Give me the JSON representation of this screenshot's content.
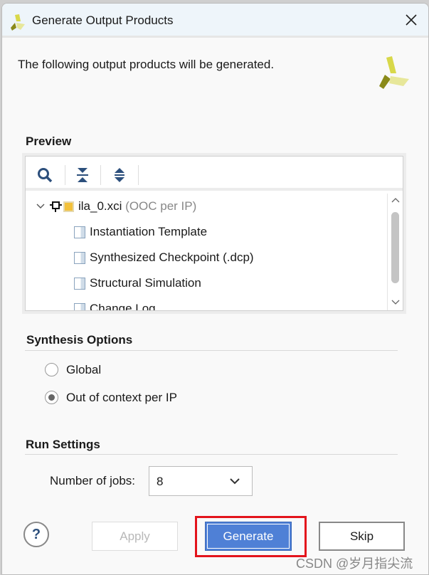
{
  "window": {
    "title": "Generate Output Products",
    "close_icon": "close-icon"
  },
  "intro": "The following output products will be generated.",
  "preview": {
    "header": "Preview",
    "toolbar": [
      "search-icon",
      "collapse-all-icon",
      "expand-all-icon"
    ],
    "root": {
      "name": "ila_0.xci",
      "note": "(OOC per IP)"
    },
    "items": [
      "Instantiation Template",
      "Synthesized Checkpoint (.dcp)",
      "Structural Simulation",
      "Change Log"
    ]
  },
  "synthesis": {
    "header": "Synthesis Options",
    "options": [
      {
        "label": "Global",
        "selected": false
      },
      {
        "label": "Out of context per IP",
        "selected": true
      }
    ]
  },
  "run": {
    "header": "Run Settings",
    "jobs_label": "Number of jobs:",
    "jobs_value": "8"
  },
  "buttons": {
    "apply": "Apply",
    "generate": "Generate",
    "skip": "Skip",
    "help": "?"
  },
  "colors": {
    "primary": "#4f80d6",
    "highlight": "#e3141c"
  },
  "watermark": "CSDN @岁月指尖流"
}
